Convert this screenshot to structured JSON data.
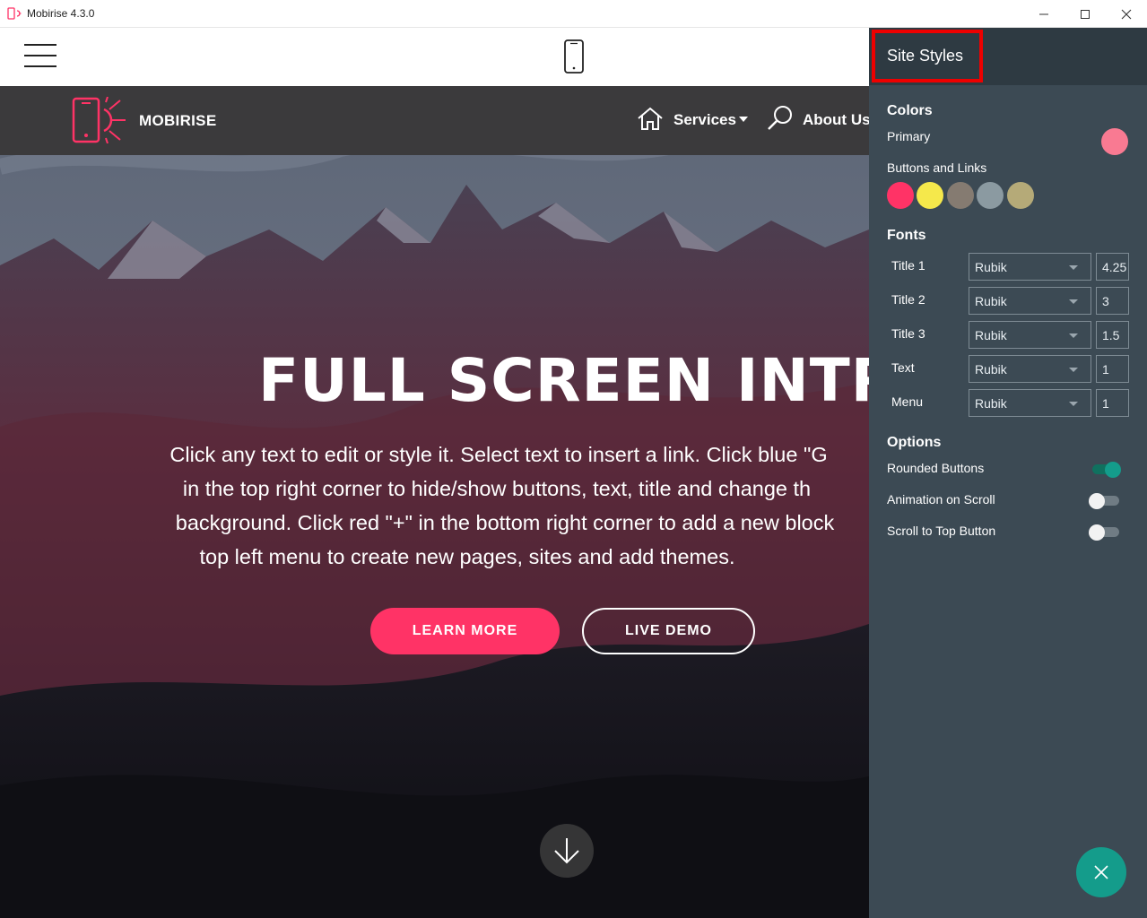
{
  "window": {
    "title": "Mobirise 4.3.0"
  },
  "editor": {
    "menu_icon": "hamburger-icon",
    "device_icon": "mobile-phone-icon"
  },
  "site": {
    "brand": "MOBIRISE",
    "nav": {
      "services": "Services",
      "about": "About Us"
    },
    "hero": {
      "title": "FULL SCREEN INTRO",
      "text_lines": [
        "Click any text to edit or style it. Select text to insert a link. Click blue \"G",
        "in the top right corner to hide/show buttons, text, title and change th",
        "background. Click red \"+\" in the bottom right corner to add a new block",
        "top left menu to create new pages, sites and add themes."
      ],
      "button_primary": "LEARN MORE",
      "button_secondary": "LIVE DEMO"
    },
    "colors": {
      "accent": "#ff3366"
    }
  },
  "panel": {
    "title": "Site Styles",
    "colors_heading": "Colors",
    "primary_label": "Primary",
    "primary_color": "#f97a92",
    "buttons_links_label": "Buttons and Links",
    "swatches": [
      "#ff3366",
      "#f5e84b",
      "#857b71",
      "#8b9aa1",
      "#b5aa78"
    ],
    "fonts_heading": "Fonts",
    "fonts": [
      {
        "label": "Title 1",
        "font": "Rubik",
        "size": "4.25"
      },
      {
        "label": "Title 2",
        "font": "Rubik",
        "size": "3"
      },
      {
        "label": "Title 3",
        "font": "Rubik",
        "size": "1.5"
      },
      {
        "label": "Text",
        "font": "Rubik",
        "size": "1"
      },
      {
        "label": "Menu",
        "font": "Rubik",
        "size": "1"
      }
    ],
    "options_heading": "Options",
    "options": [
      {
        "label": "Rounded Buttons",
        "on": true
      },
      {
        "label": "Animation on Scroll",
        "on": false
      },
      {
        "label": "Scroll to Top Button",
        "on": false
      }
    ],
    "toggle_on_color": "#149c8b"
  }
}
